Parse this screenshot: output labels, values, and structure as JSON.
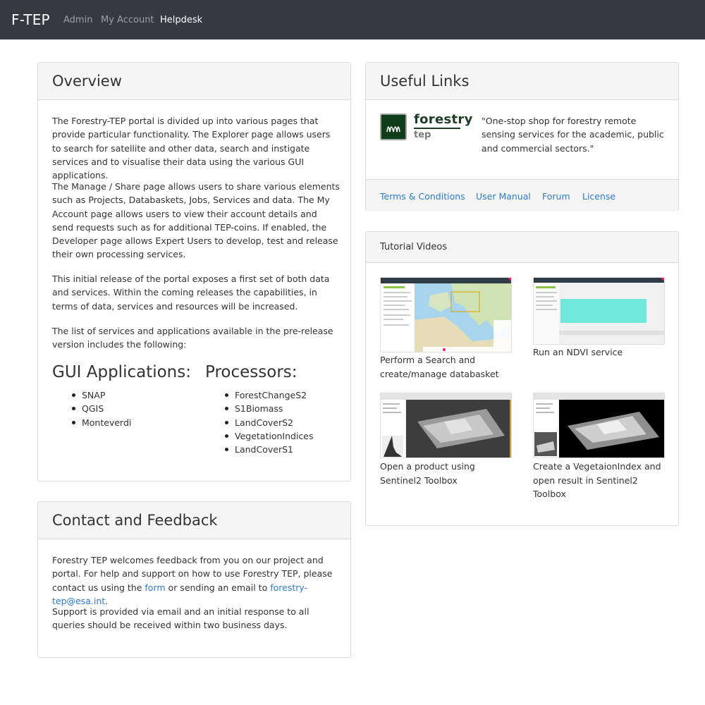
{
  "nav": {
    "brand": "F-TEP",
    "links": [
      {
        "label": "Admin",
        "active": false
      },
      {
        "label": "My Account",
        "active": false
      },
      {
        "label": "Helpdesk",
        "active": true
      }
    ]
  },
  "overview": {
    "title": "Overview",
    "paragraphs": [
      "The Forestry-TEP portal is divided up into various pages that provide particular functionality. The Explorer page allows users to search for satellite and other data, search and instigate services and to visualise their data using the various GUI applications.",
      "The Manage / Share page allows users to share various elements such as Projects, Databaskets, Jobs, Services and data. The My Account page allows users to view their account details and send requests such as for additional TEP-coins. If enabled, the Developer page allows Expert Users to develop, test and release their own processing services.",
      "This initial release of the portal exposes a first set of both data and services. Within the coming releases the capabilities, in terms of data, services and resources will be increased.",
      "The list of services and applications available in the pre-release version includes the following:"
    ],
    "gui_heading": "GUI Applications:",
    "gui_apps": [
      "SNAP",
      "QGIS",
      "Monteverdi"
    ],
    "proc_heading": "Processors:",
    "processors": [
      "ForestChangeS2",
      "S1Biomass",
      "LandCoverS2",
      "VegetationIndices",
      "LandCoverS1"
    ]
  },
  "contact": {
    "title": "Contact and Feedback",
    "p1_text": "Forestry TEP welcomes feedback from you on our project and portal. For help and support on how to use Forestry TEP, please contact us using the",
    "p1_link1": "form",
    "p1_mid": "or sending an email to",
    "p1_link2": "forestry-tep@esa.int",
    "p1_end": ".",
    "p2": "Support is provided via email and an initial response to all queries should be received within two business days."
  },
  "useful_links": {
    "title": "Useful Links",
    "logo_word": "forestry",
    "logo_sub": "tep",
    "quote": "\"One-stop shop for forestry remote sensing services for the academic, public and commercial sectors.\"",
    "links": [
      "Terms & Conditions",
      "User Manual",
      "Forum",
      "License"
    ]
  },
  "tutorials": {
    "title": "Tutorial Videos",
    "videos": [
      {
        "caption": "Perform a Search and create/manage databasket"
      },
      {
        "caption": "Run an NDVI service"
      },
      {
        "caption": "Open a product using Sentinel2 Toolbox"
      },
      {
        "caption": "Create a VegetaionIndex and open result in Sentinel2 Toolbox"
      }
    ]
  },
  "colors": {
    "navbar": "#343a40",
    "link": "#2a7ad1",
    "panel_heading": "#f5f5f5",
    "logo_green": "#1e5a2a"
  }
}
